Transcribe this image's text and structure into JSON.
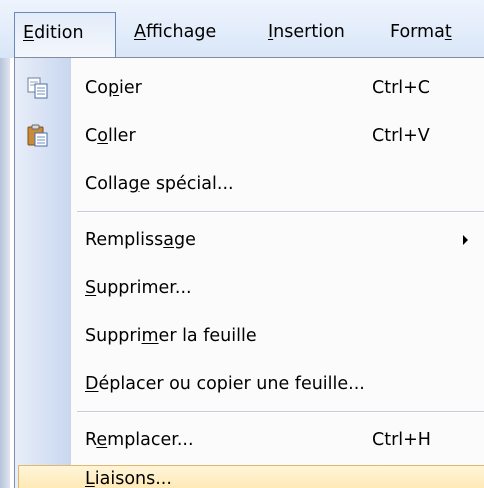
{
  "menubar": {
    "items": [
      {
        "label_u": "E",
        "label_rest": "dition"
      },
      {
        "label_u": "A",
        "label_rest": "ffichage"
      },
      {
        "label_u": "I",
        "label_rest": "nsertion"
      },
      {
        "label_pre": "Forma",
        "label_u": "t"
      }
    ]
  },
  "menu": {
    "copy": {
      "pre": "Co",
      "u": "p",
      "post": "ier",
      "shortcut": "Ctrl+C"
    },
    "paste": {
      "pre": "C",
      "u": "o",
      "post": "ller",
      "shortcut": "Ctrl+V"
    },
    "paste_special": {
      "pre": "Colla",
      "u": "g",
      "post": "e spécial..."
    },
    "fill": {
      "pre": "Rempliss",
      "u": "a",
      "post": "ge"
    },
    "delete": {
      "pre": "",
      "u": "S",
      "post": "upprimer..."
    },
    "delete_sheet": {
      "pre": "Suppri",
      "u": "m",
      "post": "er la feuille"
    },
    "move_copy": {
      "pre": "",
      "u": "D",
      "post": "éplacer ou copier une feuille..."
    },
    "replace": {
      "pre": "R",
      "u": "e",
      "post": "mplacer...",
      "shortcut": "Ctrl+H"
    },
    "links": {
      "pre": "",
      "u": "L",
      "post": "iaisons..."
    }
  },
  "icons": {
    "copy": "copy-icon",
    "paste": "paste-icon"
  },
  "colors": {
    "highlight": "#ffe8b0",
    "gutter": "#c8d7ef"
  }
}
